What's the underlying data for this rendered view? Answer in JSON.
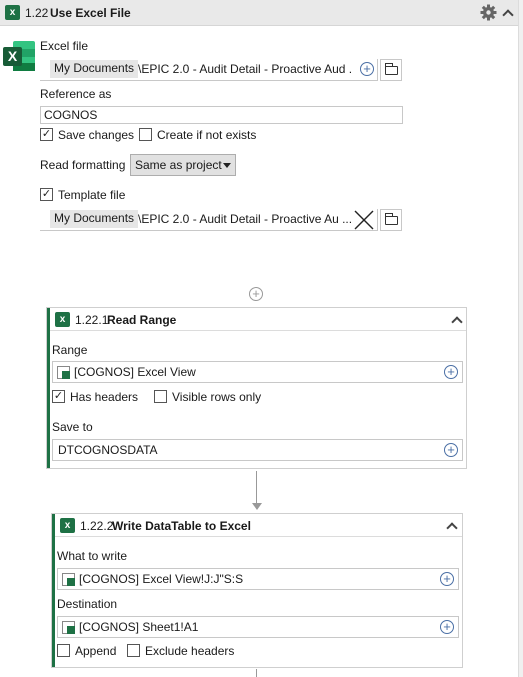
{
  "main_action": {
    "number": "1.22",
    "title": "Use Excel File",
    "excel_file_label": "Excel file",
    "excel_file_chip": "My Documents",
    "excel_file_path": "\\EPIC 2.0 - Audit Detail - Proactive Aud ...",
    "reference_label": "Reference as",
    "reference_value": "COGNOS",
    "save_changes_label": "Save changes",
    "save_changes_checked": true,
    "create_if_not_exists_label": "Create if not exists",
    "create_if_not_exists_checked": false,
    "read_formatting_label": "Read formatting",
    "read_formatting_value": "Same as project",
    "template_file_label": "Template file",
    "template_file_checked": true,
    "template_chip": "My Documents",
    "template_path": "\\EPIC 2.0 - Audit Detail - Proactive Au ..."
  },
  "read_range": {
    "number": "1.22.1",
    "title": "Read Range",
    "range_label": "Range",
    "range_value": "[COGNOS] Excel View",
    "has_headers_label": "Has headers",
    "has_headers_checked": true,
    "visible_rows_label": "Visible rows only",
    "visible_rows_checked": false,
    "save_to_label": "Save to",
    "save_to_value": "DTCOGNOSDATA"
  },
  "write_datatable": {
    "number": "1.22.2",
    "title": "Write DataTable to Excel",
    "what_to_write_label": "What to write",
    "what_to_write_value": "[COGNOS] Excel View!J:J\"S:S",
    "destination_label": "Destination",
    "destination_value": "[COGNOS] Sheet1!A1",
    "append_label": "Append",
    "append_checked": false,
    "exclude_headers_label": "Exclude headers",
    "exclude_headers_checked": false
  },
  "colors": {
    "excel_green": "#1e7145",
    "header_bg": "#e9e9e9",
    "link_blue": "#4a6fa5"
  }
}
